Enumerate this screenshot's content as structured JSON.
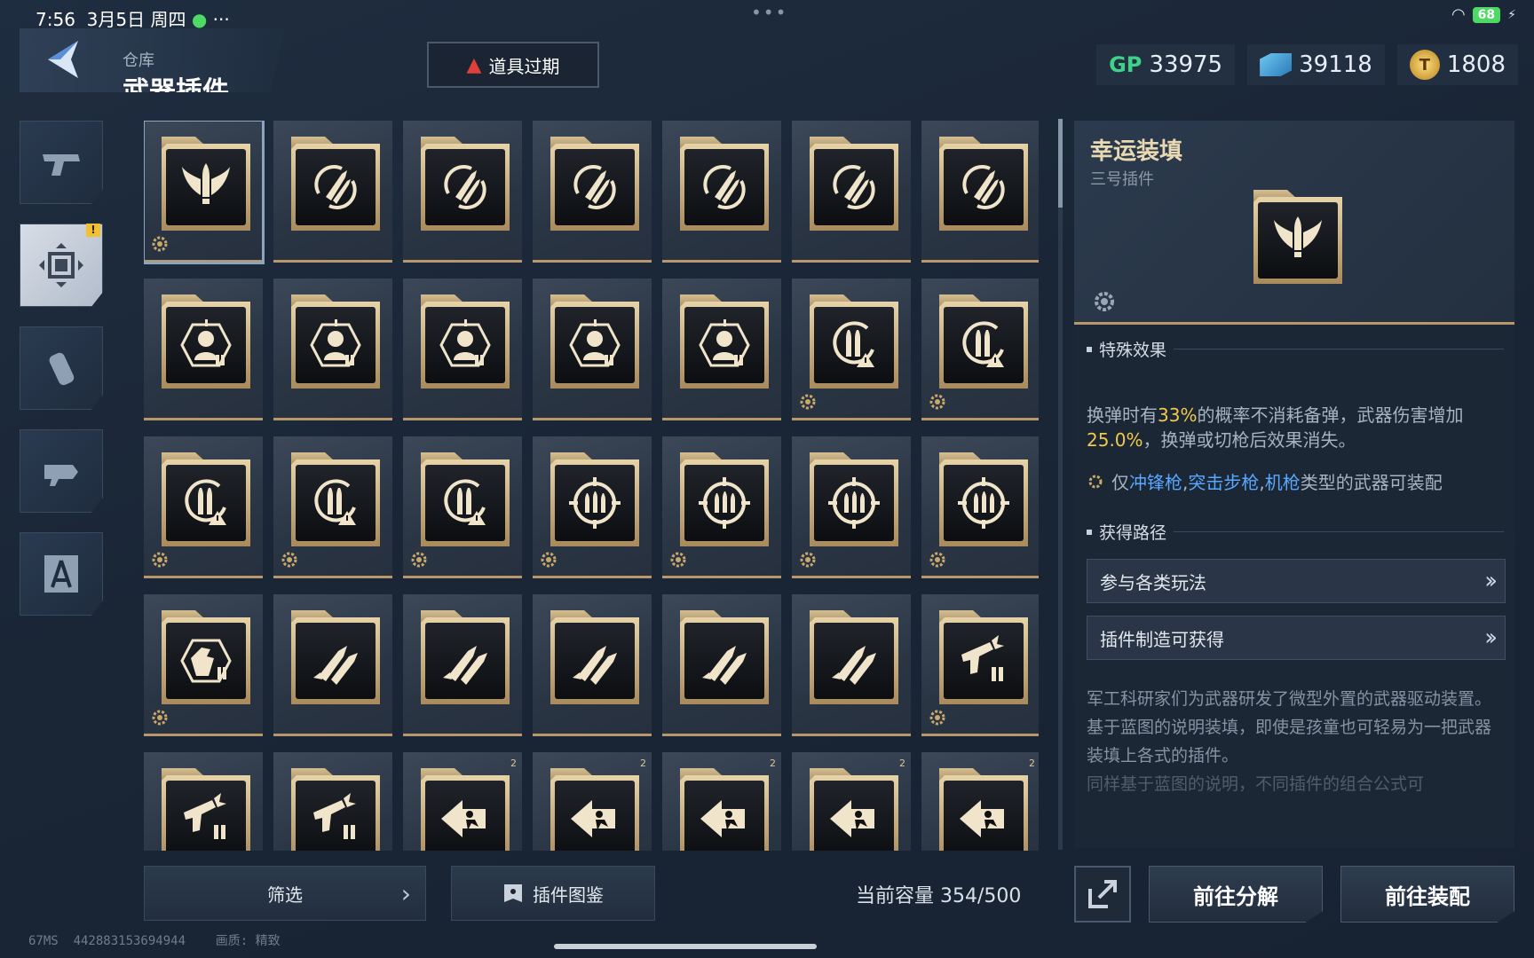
{
  "status": {
    "time": "7:56",
    "date": "3月5日 周四",
    "battery": "68"
  },
  "header": {
    "crumb": "仓库",
    "title": "武器插件",
    "warning": "道具过期"
  },
  "currencies": [
    {
      "icon": "GP",
      "value": "33975"
    },
    {
      "icon": "cube-icon",
      "value": "39118"
    },
    {
      "icon": "coin-icon",
      "value": "1808"
    }
  ],
  "sidebar": [
    {
      "name": "pistol",
      "active": false,
      "alert": ""
    },
    {
      "name": "plugin",
      "active": true,
      "alert": "!"
    },
    {
      "name": "grenade",
      "active": false,
      "alert": ""
    },
    {
      "name": "drone",
      "active": false,
      "alert": ""
    },
    {
      "name": "blueprint",
      "active": false,
      "alert": ""
    }
  ],
  "grid": {
    "rows": [
      [
        "wing-bullet",
        "rocket-cycle",
        "rocket-cycle",
        "rocket-cycle",
        "rocket-cycle",
        "rocket-cycle",
        "rocket-cycle"
      ],
      [
        "target-head",
        "target-head",
        "target-head",
        "target-head",
        "target-head",
        "reload-warn",
        "reload-warn"
      ],
      [
        "reload-warn",
        "reload-warn",
        "reload-warn",
        "crosshair-bullets",
        "crosshair-bullets",
        "crosshair-bullets",
        "crosshair-bullets"
      ],
      [
        "hand-shield",
        "twin-rockets",
        "twin-rockets",
        "twin-rockets",
        "twin-rockets",
        "twin-rockets",
        "gun-ammo"
      ],
      [
        "gun-ammo",
        "gun-ammo",
        "runner-arrow",
        "runner-arrow",
        "runner-arrow",
        "runner-arrow",
        "runner-arrow"
      ]
    ],
    "gears": [
      [
        1,
        0,
        0,
        0,
        0,
        0,
        0
      ],
      [
        0,
        0,
        0,
        0,
        0,
        1,
        1
      ],
      [
        1,
        1,
        1,
        1,
        1,
        1,
        1
      ],
      [
        1,
        0,
        0,
        0,
        0,
        0,
        1
      ],
      [
        0,
        0,
        0,
        0,
        0,
        0,
        0
      ]
    ],
    "badges": [
      [
        0,
        0,
        0,
        0,
        0,
        0,
        0
      ],
      [
        0,
        0,
        0,
        0,
        0,
        0,
        0
      ],
      [
        0,
        0,
        0,
        0,
        0,
        0,
        0
      ],
      [
        0,
        0,
        0,
        0,
        0,
        0,
        0
      ],
      [
        0,
        0,
        2,
        2,
        2,
        2,
        2
      ]
    ]
  },
  "detail": {
    "name": "幸运装填",
    "sub": "三号插件",
    "effect_head": "特殊效果",
    "effect": {
      "p1": "换弹时有",
      "pct1": "33%",
      "p2": "的概率不消耗备弹，武器伤害增加",
      "pct2": "25.0%",
      "p3": "，换弹或切枪后效果消失。"
    },
    "restrict": {
      "pre": "仅",
      "w1": "冲锋枪",
      "sep1": ",",
      "w2": "突击步枪",
      "sep2": ",",
      "w3": "机枪",
      "post": "类型的武器可装配"
    },
    "route_head": "获得路径",
    "routes": [
      "参与各类玩法",
      "插件制造可获得"
    ],
    "desc": [
      "军工科研家们为武器研发了微型外置的武器驱动装置。",
      "基于蓝图的说明装填，即使是孩童也可轻易为一把武器装填上各式的插件。",
      "同样基于蓝图的说明，不同插件的组合公式可"
    ]
  },
  "bottom": {
    "filter": "筛选",
    "atlas": "插件图鉴",
    "capacity_label": "当前容量",
    "capacity": "354/500",
    "decompose": "前往分解",
    "equip": "前往装配"
  },
  "footer": {
    "ping": "67MS",
    "uid": "442883153694944",
    "quality_label": "画质:",
    "quality": "精致"
  }
}
